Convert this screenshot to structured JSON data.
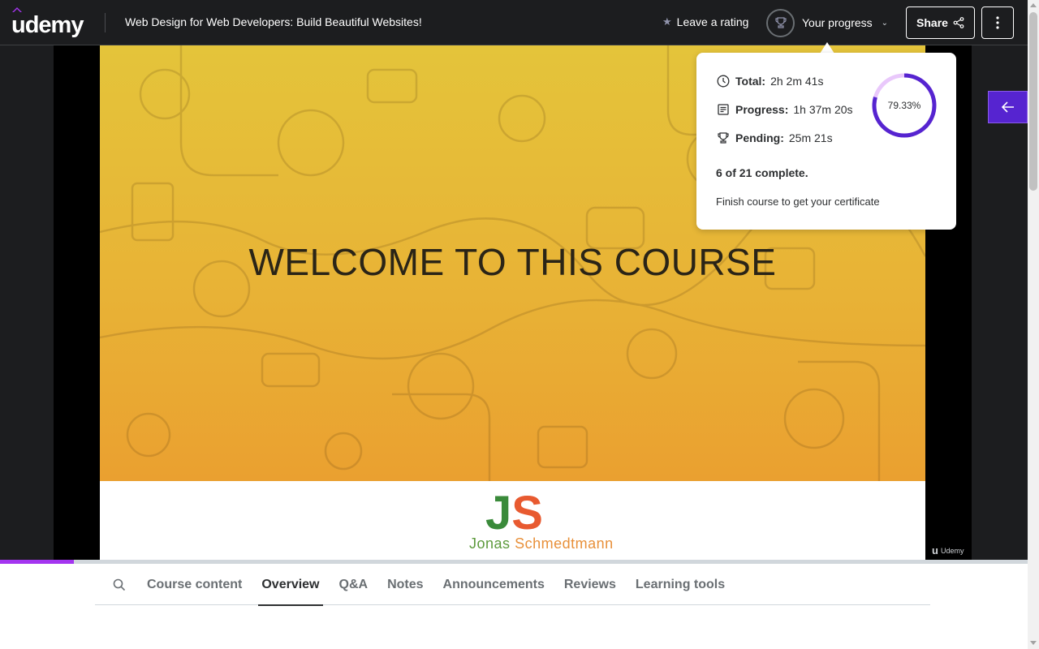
{
  "header": {
    "logo_text": "udemy",
    "course_title": "Web Design for Web Developers: Build Beautiful Websites!",
    "rating_label": "Leave a rating",
    "progress_label": "Your progress",
    "share_label": "Share"
  },
  "video": {
    "slide_title": "WELCOME TO THIS COURSE",
    "logo_j": "J",
    "logo_s": "S",
    "author_first": "Jonas",
    "author_last": "Schmedtmann",
    "watermark": "Udemy",
    "playback_fraction": 0.072
  },
  "progress_popover": {
    "total_label": "Total:",
    "total_value": "2h 2m 41s",
    "progress_label": "Progress:",
    "progress_value": "1h 37m 20s",
    "pending_label": "Pending:",
    "pending_value": "25m 21s",
    "percent_text": "79.33%",
    "percent_value": 79.33,
    "complete_text": "6 of 21 complete.",
    "certificate_text": "Finish course to get your certificate"
  },
  "tabs": [
    {
      "label": "Course content",
      "active": false
    },
    {
      "label": "Overview",
      "active": true
    },
    {
      "label": "Q&A",
      "active": false
    },
    {
      "label": "Notes",
      "active": false
    },
    {
      "label": "Announcements",
      "active": false
    },
    {
      "label": "Reviews",
      "active": false
    },
    {
      "label": "Learning tools",
      "active": false
    }
  ],
  "colors": {
    "brand_purple": "#a435f0",
    "ring_purple": "#5624d0",
    "ring_track": "#e9c8fb",
    "header_bg": "#1c1d1f"
  },
  "icons": {
    "star": "star-icon",
    "trophy": "trophy-icon",
    "share": "share-icon",
    "more": "more-vertical-icon",
    "arrow_left": "arrow-left-icon",
    "clock": "clock-icon",
    "progress": "progress-list-icon",
    "search": "search-icon"
  }
}
